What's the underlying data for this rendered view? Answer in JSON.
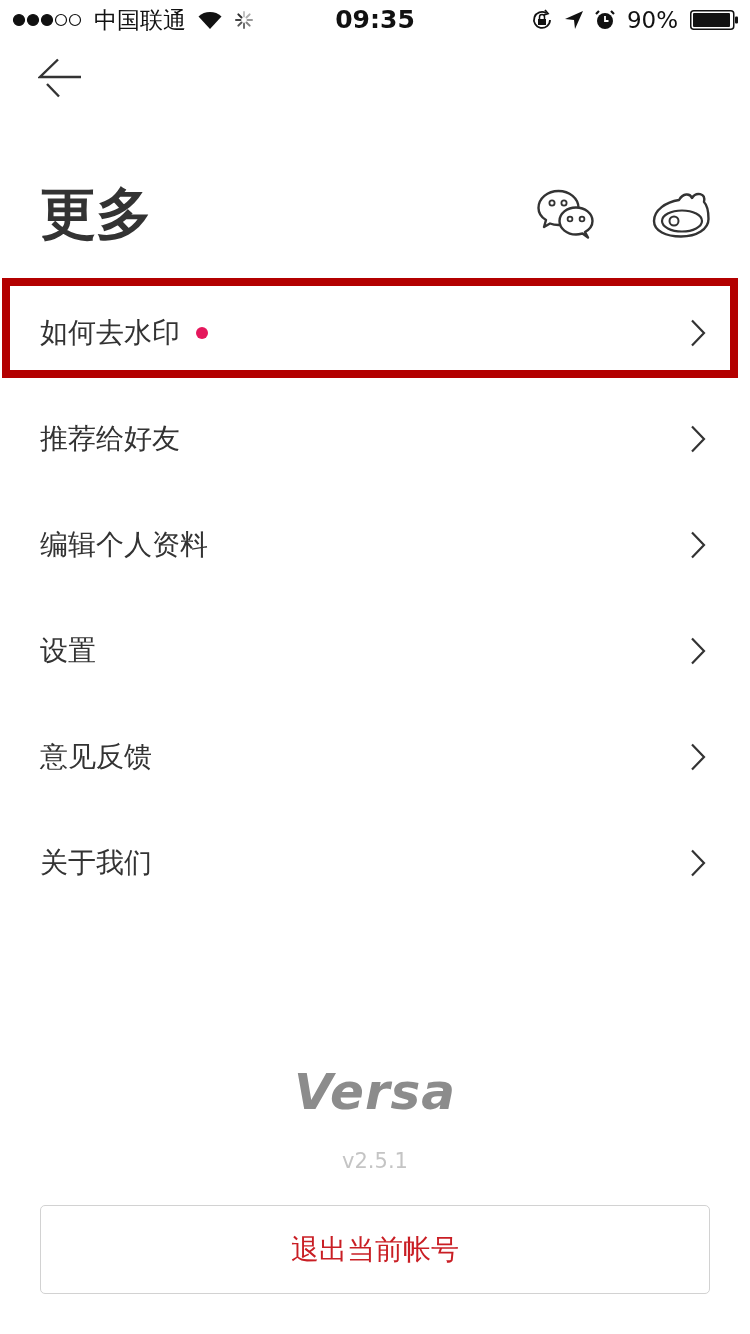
{
  "status_bar": {
    "carrier": "中国联通",
    "time": "09:35",
    "battery": "90%"
  },
  "header": {
    "title": "更多"
  },
  "menu": [
    {
      "label": "如何去水印",
      "unread": true,
      "highlighted": true
    },
    {
      "label": "推荐给好友",
      "unread": false,
      "highlighted": false
    },
    {
      "label": "编辑个人资料",
      "unread": false,
      "highlighted": false
    },
    {
      "label": "设置",
      "unread": false,
      "highlighted": false
    },
    {
      "label": "意见反馈",
      "unread": false,
      "highlighted": false
    },
    {
      "label": "关于我们",
      "unread": false,
      "highlighted": false
    }
  ],
  "footer": {
    "logo": "Versa",
    "version": "v2.5.1",
    "logout_button": "退出当前帐号"
  }
}
